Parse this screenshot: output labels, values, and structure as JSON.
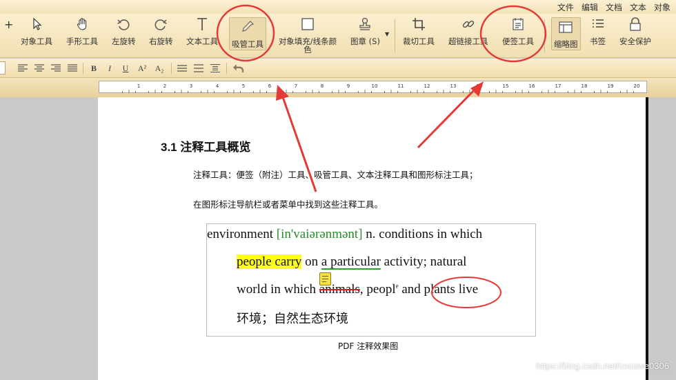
{
  "menu": [
    "文件",
    "编辑",
    "文档",
    "文本",
    "对象"
  ],
  "toolbar": {
    "plus": "+",
    "object_tool": "对象工具",
    "hand_tool": "手形工具",
    "rotate_left": "左旋转",
    "rotate_right": "右旋转",
    "text_tool": "文本工具",
    "eyedropper_tool": "吸管工具",
    "fill_color": "对象填充/线条颜色",
    "stamp": "图章 (S)",
    "crop_tool": "裁切工具",
    "link_tool": "超链接工具",
    "note_tool": "便签工具",
    "thumbnail": "缩略图",
    "bookmark": "书签",
    "security": "安全保护"
  },
  "format": {
    "bold": "B",
    "italic": "I",
    "underline": "U",
    "superscript": "A²",
    "subscript": "A₂"
  },
  "ruler_numbers": [
    "1",
    "2",
    "3",
    "4",
    "5",
    "6",
    "7",
    "8",
    "9",
    "10",
    "11",
    "12",
    "13",
    "14",
    "15",
    "16",
    "17",
    "18",
    "19",
    "20"
  ],
  "doc": {
    "heading": "3.1 注释工具概览",
    "para1": "注释工具：便签（附注）工具、吸管工具、文本注释工具和图形标注工具；",
    "para2": "在图形标注导航栏或者菜单中找到这些注释工具。",
    "sample": {
      "l1a": "environment ",
      "l1b": "[in'vaiərənmənt]",
      "l1c": " n. conditions in which",
      "l2a": "people carry",
      "l2b": " on ",
      "l2c": "a particular",
      "l2d": " activity; natural",
      "l3a": "world in which ",
      "l3b": "animals",
      "l3c": ", peopl",
      "l3d": "e",
      "l3e": " and plants",
      "l3f": " live",
      "l4": "环境；自然生态环境"
    },
    "caption": "PDF 注释效果图"
  },
  "watermark": "https://blog.csdn.net/cocowe0306",
  "colors": {
    "annotation": "#e53935",
    "highlight": "#ffff1a",
    "underline": "#2aa12a",
    "toolbar": "#f3e3b9"
  }
}
